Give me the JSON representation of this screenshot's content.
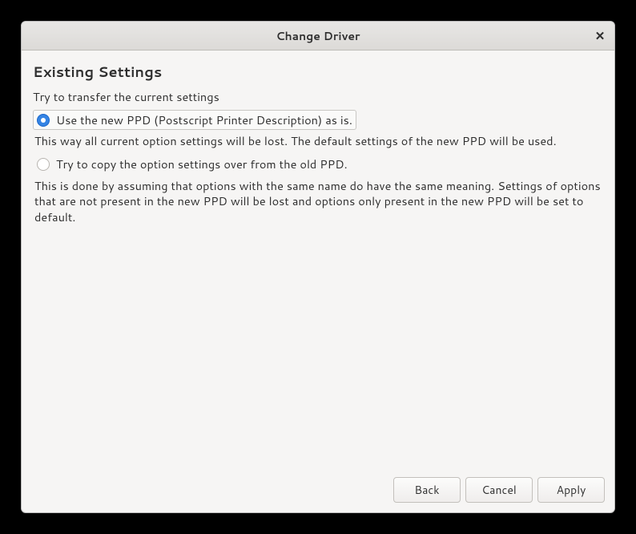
{
  "titlebar": {
    "title": "Change Driver",
    "close": "✕"
  },
  "content": {
    "heading": "Existing Settings",
    "subheading": "Try to transfer the current settings",
    "options": [
      {
        "label": "Use the new PPD (Postscript Printer Description) as is.",
        "selected": true,
        "description": "This way all current option settings will be lost. The default settings of the new PPD will be used."
      },
      {
        "label": "Try to copy the option settings over from the old PPD.",
        "selected": false,
        "description": "This is done by assuming that options with the same name do have the same meaning. Settings of options that are not present in the new PPD will be lost and options only present in the new PPD will be set to default."
      }
    ]
  },
  "footer": {
    "back": "Back",
    "cancel": "Cancel",
    "apply": "Apply"
  }
}
